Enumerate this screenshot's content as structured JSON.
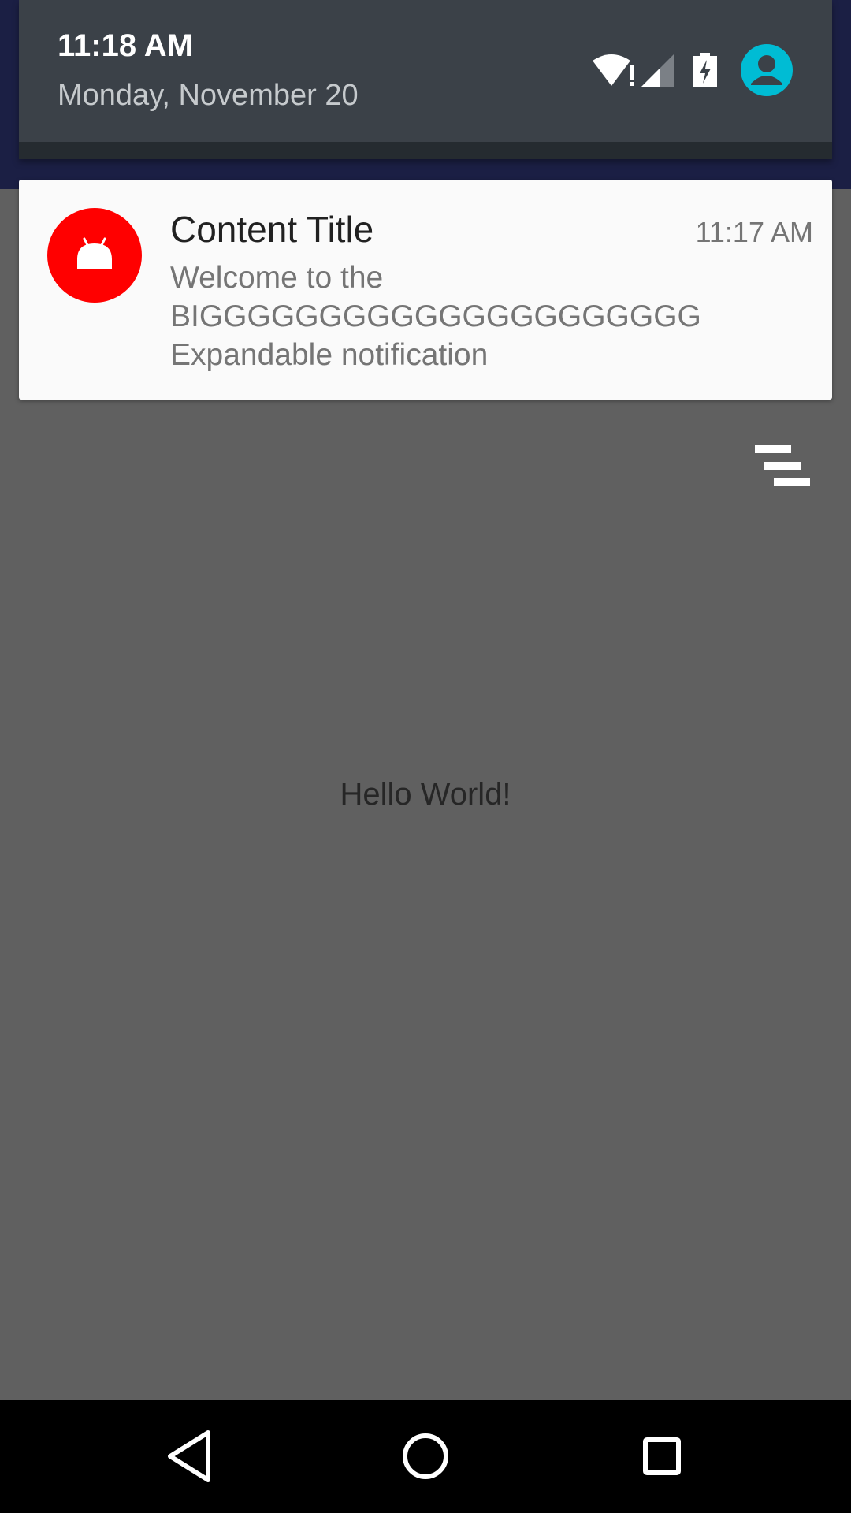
{
  "status_header": {
    "time": "11:18 AM",
    "date": "Monday, November 20",
    "icons": [
      "wifi-alert-icon",
      "cell-signal-icon",
      "battery-charging-icon",
      "user-avatar-icon"
    ]
  },
  "notification": {
    "title": "Content Title",
    "time": "11:17 AM",
    "text_lines": [
      "Welcome to the",
      "BIGGGGGGGGGGGGGGGGGGGGG",
      "Expandable notification"
    ],
    "icon": "android-robot-icon",
    "icon_color": "#ff0000"
  },
  "shade": {
    "dismiss_all_icon": "clear-all-icon"
  },
  "app": {
    "hello_text": "Hello World!"
  },
  "navbar": {
    "buttons": [
      "back-icon",
      "home-icon",
      "recents-icon"
    ]
  },
  "colors": {
    "header_bg": "#3b4148",
    "card_bg": "#fafafa",
    "scrim_bg": "#606060",
    "avatar": "#00bcd4"
  }
}
